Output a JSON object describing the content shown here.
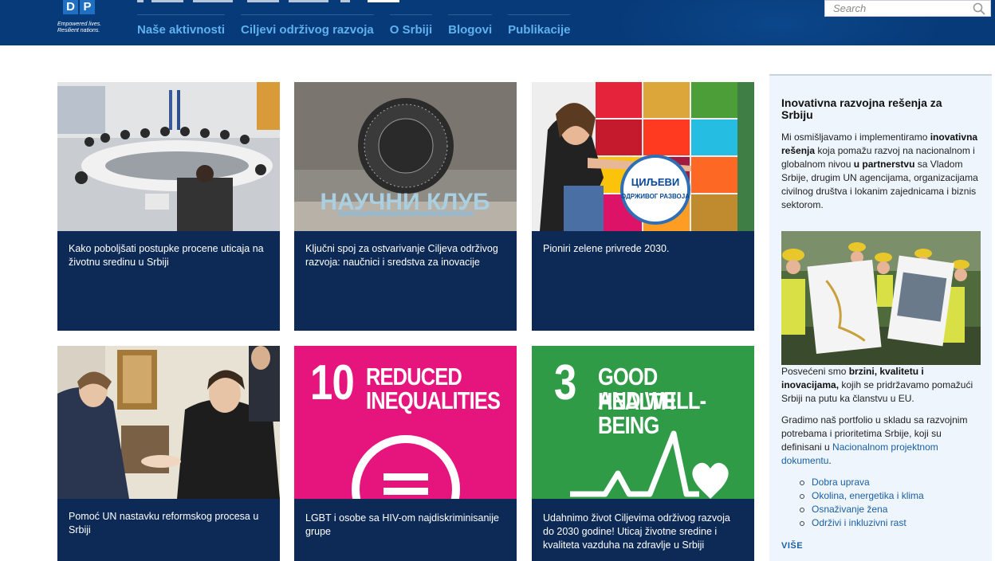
{
  "header": {
    "logo_letters": [
      "D",
      "P"
    ],
    "tagline_1": "Empowered lives.",
    "tagline_2": "Resilient nations.",
    "nav": [
      "Naše aktivnosti",
      "Ciljevi održivog razvoja",
      "O Srbiji",
      "Blogovi",
      "Publikacije"
    ],
    "search_placeholder": "Search",
    "colors": {
      "background": "#073a78",
      "nav_link": "#5fb1f0"
    }
  },
  "cards": [
    {
      "title": "Kako poboljšati postupke procene uticaja na životnu sredinu u Srbiji"
    },
    {
      "title": "Ključni spoj za ostvarivanje Ciljeva održivog razvoja: naučnici i sredstva za inovacije",
      "image_sign": "НАУЧНИ КЛУБ"
    },
    {
      "title": "Pioniri zelene privrede 2030.",
      "image_text": "ЦИЉЕВИ ОДРЖИВОГ РАЗВОЈА"
    },
    {
      "title": "Pomoć UN nastavku reformskog procesa u Srbiji"
    },
    {
      "title": "LGBT i osobe sa HIV-om najdiskriminisanije grupe",
      "sdg_number": "10",
      "sdg_line1": "REDUCED",
      "sdg_line2": "INEQUALITIES",
      "color": "#e5157d"
    },
    {
      "title": "Udahnimo život Ciljevima održivog razvoja do 2030 godine! Uticaj životne sredine i kvaliteta vazduha na zdravlje u Srbiji",
      "sdg_number": "3",
      "sdg_line1": "GOOD HEALTH",
      "sdg_line2": "AND WELL-BEING",
      "color": "#2f9b47"
    }
  ],
  "sidebar": {
    "heading": "Inovativna razvojna rešenja za Srbiju",
    "p1_a": "Mi osmišljavamo i implementiramo ",
    "p1_b": "inovativna rešenja",
    "p1_c": " koja pomažu razvoj na nacionalnom i globalnom nivou ",
    "p1_d": "u partnerstvu",
    "p1_e": " sa Vladom Srbije, drugim UN agencijama, organizacijama civilnog društva i lokanim zajednicama i biznis sektorom.",
    "p2_a": "Posvećeni smo ",
    "p2_b": "brzini, kvalitetu i inovacijama,",
    "p2_c": " kojih se pridržavamo pomažući Srbiji na putu ka članstvu u EU.",
    "p3_a": "Gradimo naš portfolio u skladu sa razvojnim potrebama i prioritetima Srbije, koji su definisani u ",
    "p3_link": "Nacionalnom projektnom dokumentu",
    "p3_end": ".",
    "list": [
      "Dobra uprava",
      "Okolina, energetika i klima",
      "Osnaživanje žena",
      "Održivi i inkluzivni rast"
    ],
    "more": "VIŠE"
  }
}
